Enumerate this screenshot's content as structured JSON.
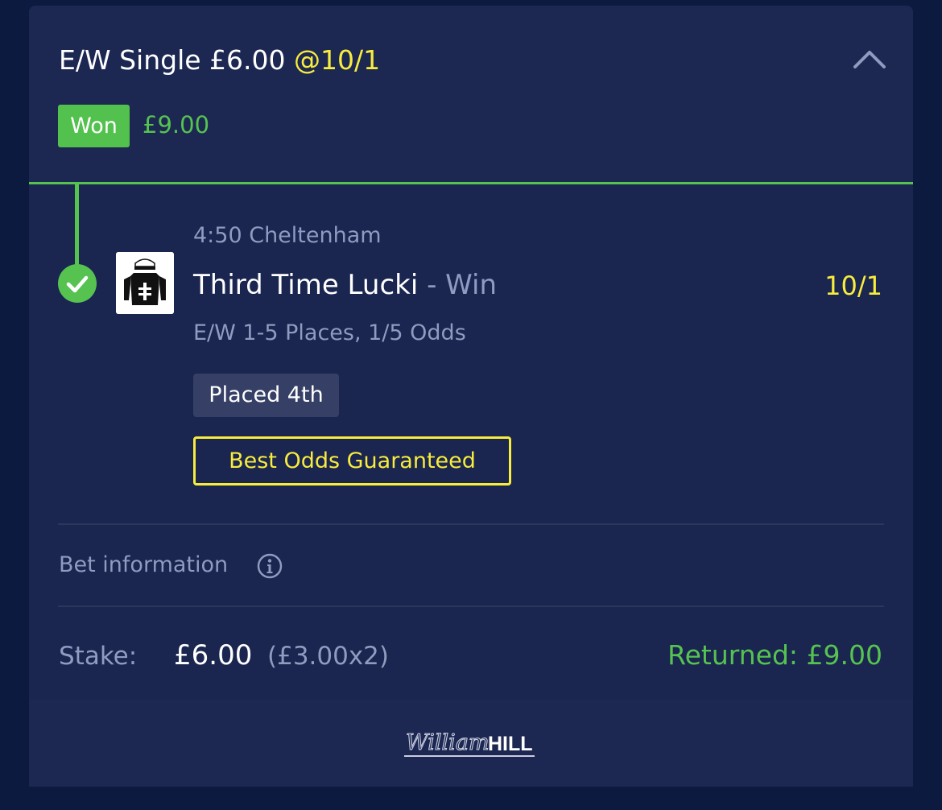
{
  "header": {
    "bet_type": "E/W Single £6.00",
    "odds": "@10/1",
    "status_label": "Won",
    "status_amount": "£9.00",
    "collapse_icon": "chevron-up-icon"
  },
  "selection": {
    "race": "4:50 Cheltenham",
    "horse": "Third Time Lucki",
    "market": " - Win",
    "odds": "10/1",
    "ew_terms": "E/W 1-5 Places, 1/5 Odds",
    "result": "Placed 4th",
    "promo": "Best Odds Guaranteed",
    "result_icon": "check-circle-icon",
    "silks_icon": "jockey-silks-icon"
  },
  "bet_info": {
    "label": "Bet information",
    "icon": "info-icon"
  },
  "summary": {
    "stake_label": "Stake:",
    "stake_value": "£6.00",
    "stake_split": "(£3.00x2)",
    "returned": "Returned: £9.00"
  },
  "footer": {
    "logo_script": "William",
    "logo_bold": "HILL"
  },
  "colors": {
    "background": "#0d1a3f",
    "card": "#1a2550",
    "accent_green": "#56c350",
    "accent_yellow": "#f8ec3c",
    "muted_text": "#8f9bbf"
  }
}
